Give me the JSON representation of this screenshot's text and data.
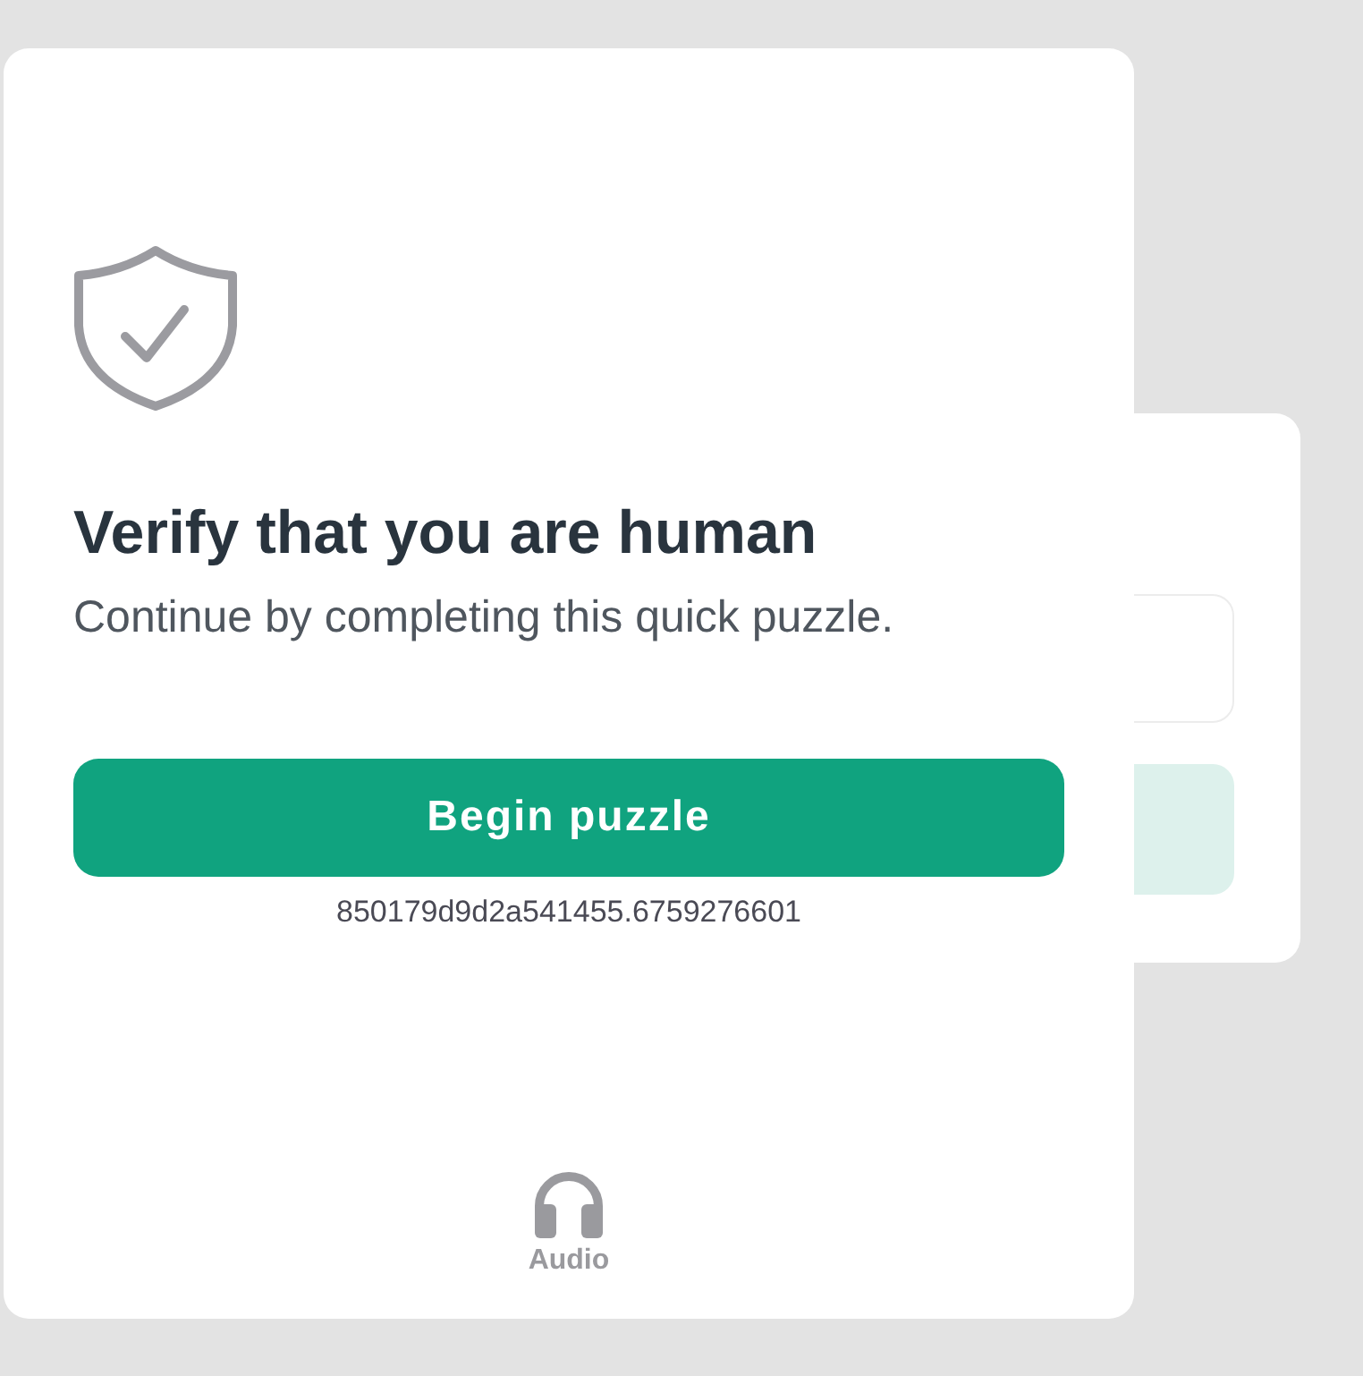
{
  "dialog": {
    "title": "Verify that you are human",
    "subtitle": "Continue by completing this quick puzzle.",
    "primary_button": "Begin puzzle",
    "session_id": "850179d9d2a541455.6759276601",
    "audio_button": "Audio"
  }
}
